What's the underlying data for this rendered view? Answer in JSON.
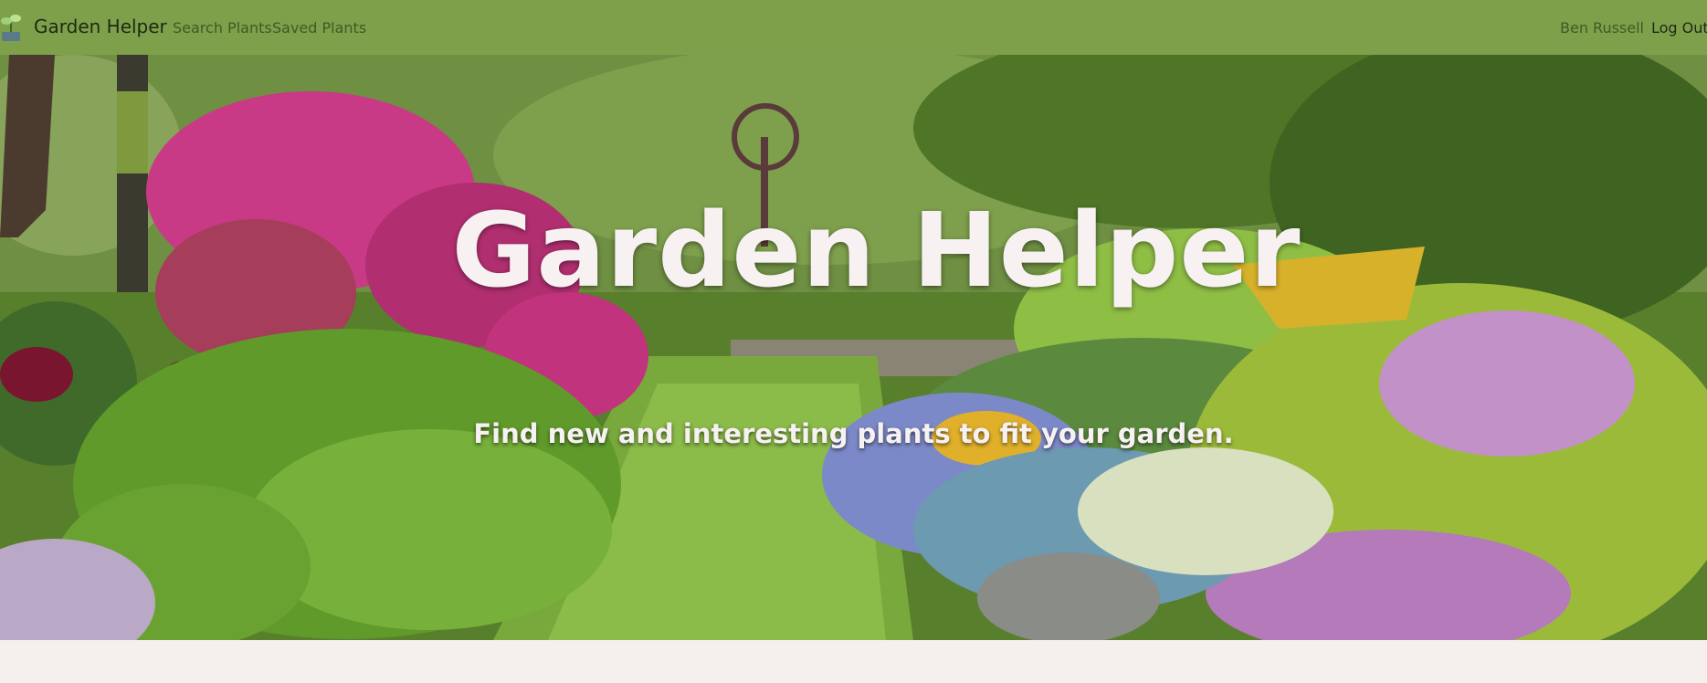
{
  "nav": {
    "brand": "Garden Helper",
    "links": [
      {
        "label": "Search Plants"
      },
      {
        "label": "Saved Plants"
      }
    ],
    "user_name": "Ben Russell",
    "logout_label": "Log Out",
    "logo_icon": "seedling-icon"
  },
  "hero": {
    "title": "Garden Helper",
    "subtitle": "Find new and interesting plants to fit your garden.",
    "image": "garden-photo"
  },
  "colors": {
    "navbar": "#7fa04b",
    "page_bg": "#f5f0ee",
    "hero_text": "#f7f1f2"
  }
}
